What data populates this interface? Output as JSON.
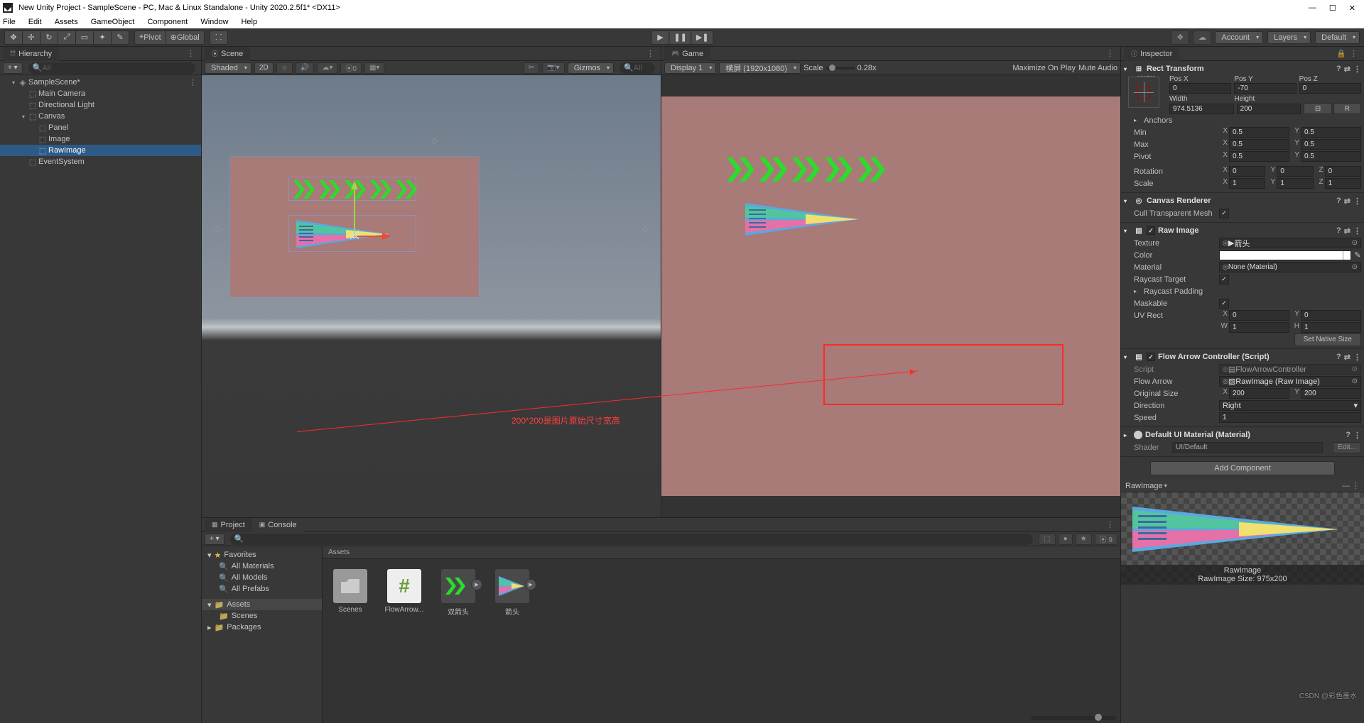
{
  "title": "New Unity Project - SampleScene - PC, Mac & Linux Standalone - Unity 2020.2.5f1* <DX11>",
  "menu": [
    "File",
    "Edit",
    "Assets",
    "GameObject",
    "Component",
    "Window",
    "Help"
  ],
  "toolbar": {
    "pivot": "Pivot",
    "globall": "Global",
    "account": "Account",
    "layers": "Layers",
    "layout": "Default"
  },
  "hierarchy": {
    "tab": "Hierarchy",
    "search_ph": "All",
    "scene": "SampleScene*",
    "nodes": [
      "Main Camera",
      "Directional Light",
      "Canvas",
      "Panel",
      "Image",
      "RawImage",
      "EventSystem"
    ]
  },
  "sceneTab": "Scene",
  "sceneBar": {
    "shading": "Shaded",
    "twoD": "2D",
    "gizmos": "Gizmos",
    "all": "All"
  },
  "gameTab": "Game",
  "gameBar": {
    "display": "Display 1",
    "res": "横屏 (1920x1080)",
    "scale": "Scale",
    "scaleVal": "0.28x",
    "maxOnPlay": "Maximize On Play",
    "muteAudio": "Mute Audio"
  },
  "project": {
    "tabs": [
      "Project",
      "Console"
    ],
    "favorites": "Favorites",
    "favItems": [
      "All Materials",
      "All Models",
      "All Prefabs"
    ],
    "assets": "Assets",
    "scenesFolder": "Scenes",
    "packages": "Packages",
    "gridHead": "Assets",
    "items": [
      "Scenes",
      "FlowArrow...",
      "双箭头",
      "箭头"
    ]
  },
  "inspector": {
    "tab": "Inspector",
    "rect": {
      "title": "Rect Transform",
      "anchH": "center",
      "anchV": "middle",
      "posX": "0",
      "posY": "-70",
      "posZ": "0",
      "width": "974.5136",
      "height": "200",
      "anchors": "Anchors",
      "minX": "0.5",
      "minY": "0.5",
      "maxX": "0.5",
      "maxY": "0.5",
      "pivotX": "0.5",
      "pivotY": "0.5",
      "rotX": "0",
      "rotY": "0",
      "rotZ": "0",
      "sclX": "1",
      "sclY": "1",
      "sclZ": "1",
      "lblPosX": "Pos X",
      "lblPosY": "Pos Y",
      "lblPosZ": "Pos Z",
      "lblWidth": "Width",
      "lblHeight": "Height",
      "lblMin": "Min",
      "lblMax": "Max",
      "lblPivot": "Pivot",
      "lblRotation": "Rotation",
      "lblScale": "Scale"
    },
    "canvasRenderer": {
      "title": "Canvas Renderer",
      "cull": "Cull Transparent Mesh"
    },
    "rawImage": {
      "title": "Raw Image",
      "texture": "Texture",
      "texVal": "箭头",
      "color": "Color",
      "material": "Material",
      "matVal": "None (Material)",
      "raycast": "Raycast Target",
      "raypad": "Raycast Padding",
      "maskable": "Maskable",
      "uvrect": "UV Rect",
      "uvX": "0",
      "uvY": "0",
      "uvW": "1",
      "uvH": "1",
      "setNative": "Set Native Size"
    },
    "flow": {
      "title": "Flow Arrow Controller (Script)",
      "script": "Script",
      "scriptVal": "FlowArrowController",
      "flowArrow": "Flow Arrow",
      "flowArrowVal": "RawImage (Raw Image)",
      "origSize": "Original Size",
      "origX": "200",
      "origY": "200",
      "direction": "Direction",
      "dirVal": "Right",
      "speed": "Speed",
      "speedVal": "1"
    },
    "material": {
      "title": "Default UI Material (Material)",
      "shader": "Shader",
      "shaderVal": "UI/Default",
      "edit": "Edit..."
    },
    "addComponent": "Add Component",
    "preview": {
      "head": "RawImage",
      "name": "RawImage",
      "size": "RawImage Size: 975x200"
    }
  },
  "annotation": "200*200是图片原始尺寸宽高",
  "watermark": "CSDN @彩色墨水"
}
